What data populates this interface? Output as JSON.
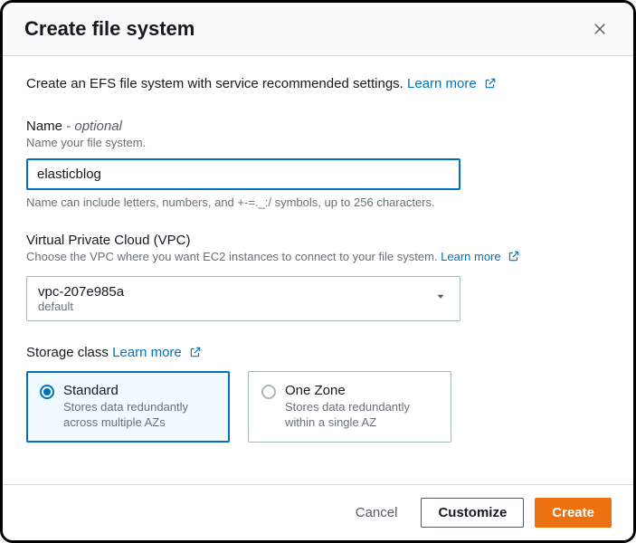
{
  "header": {
    "title": "Create file system"
  },
  "intro": {
    "text": "Create an EFS file system with service recommended settings.",
    "learn_more": "Learn more"
  },
  "name": {
    "label": "Name",
    "optional": " - optional",
    "desc": "Name your file system.",
    "value": "elasticblog",
    "hint": "Name can include letters, numbers, and +-=._:/ symbols, up to 256 characters."
  },
  "vpc": {
    "label": "Virtual Private Cloud (VPC)",
    "desc": "Choose the VPC where you want EC2 instances to connect to your file system.",
    "learn_more": "Learn more",
    "selected_id": "vpc-207e985a",
    "selected_sub": "default"
  },
  "storage": {
    "label": "Storage class",
    "learn_more": "Learn more",
    "options": [
      {
        "title": "Standard",
        "desc": "Stores data redundantly across multiple AZs",
        "selected": true
      },
      {
        "title": "One Zone",
        "desc": "Stores data redundantly within a single AZ",
        "selected": false
      }
    ]
  },
  "footer": {
    "cancel": "Cancel",
    "customize": "Customize",
    "create": "Create"
  }
}
